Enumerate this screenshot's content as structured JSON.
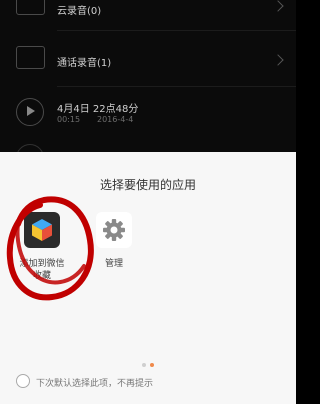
{
  "background_list": {
    "rows": [
      {
        "type": "folder",
        "label": "云录音(0)"
      },
      {
        "type": "folder",
        "label": "通话录音(1)"
      },
      {
        "type": "recording",
        "label": "4月4日 22点48分",
        "duration": "00:15",
        "date": "2016-4-4"
      }
    ]
  },
  "chooser": {
    "title": "选择要使用的应用",
    "apps": [
      {
        "label": "添加到微信\n收藏",
        "icon": "cube-app-icon"
      },
      {
        "label": "管理",
        "icon": "gear-icon"
      }
    ],
    "page_indicator": {
      "count": 2,
      "active": 1,
      "colors": {
        "active": "#f08a4b",
        "inactive": "#cfcfcf"
      }
    },
    "remember_label": "下次默认选择此项，不再提示"
  },
  "annotation": {
    "color": "#c00000"
  }
}
